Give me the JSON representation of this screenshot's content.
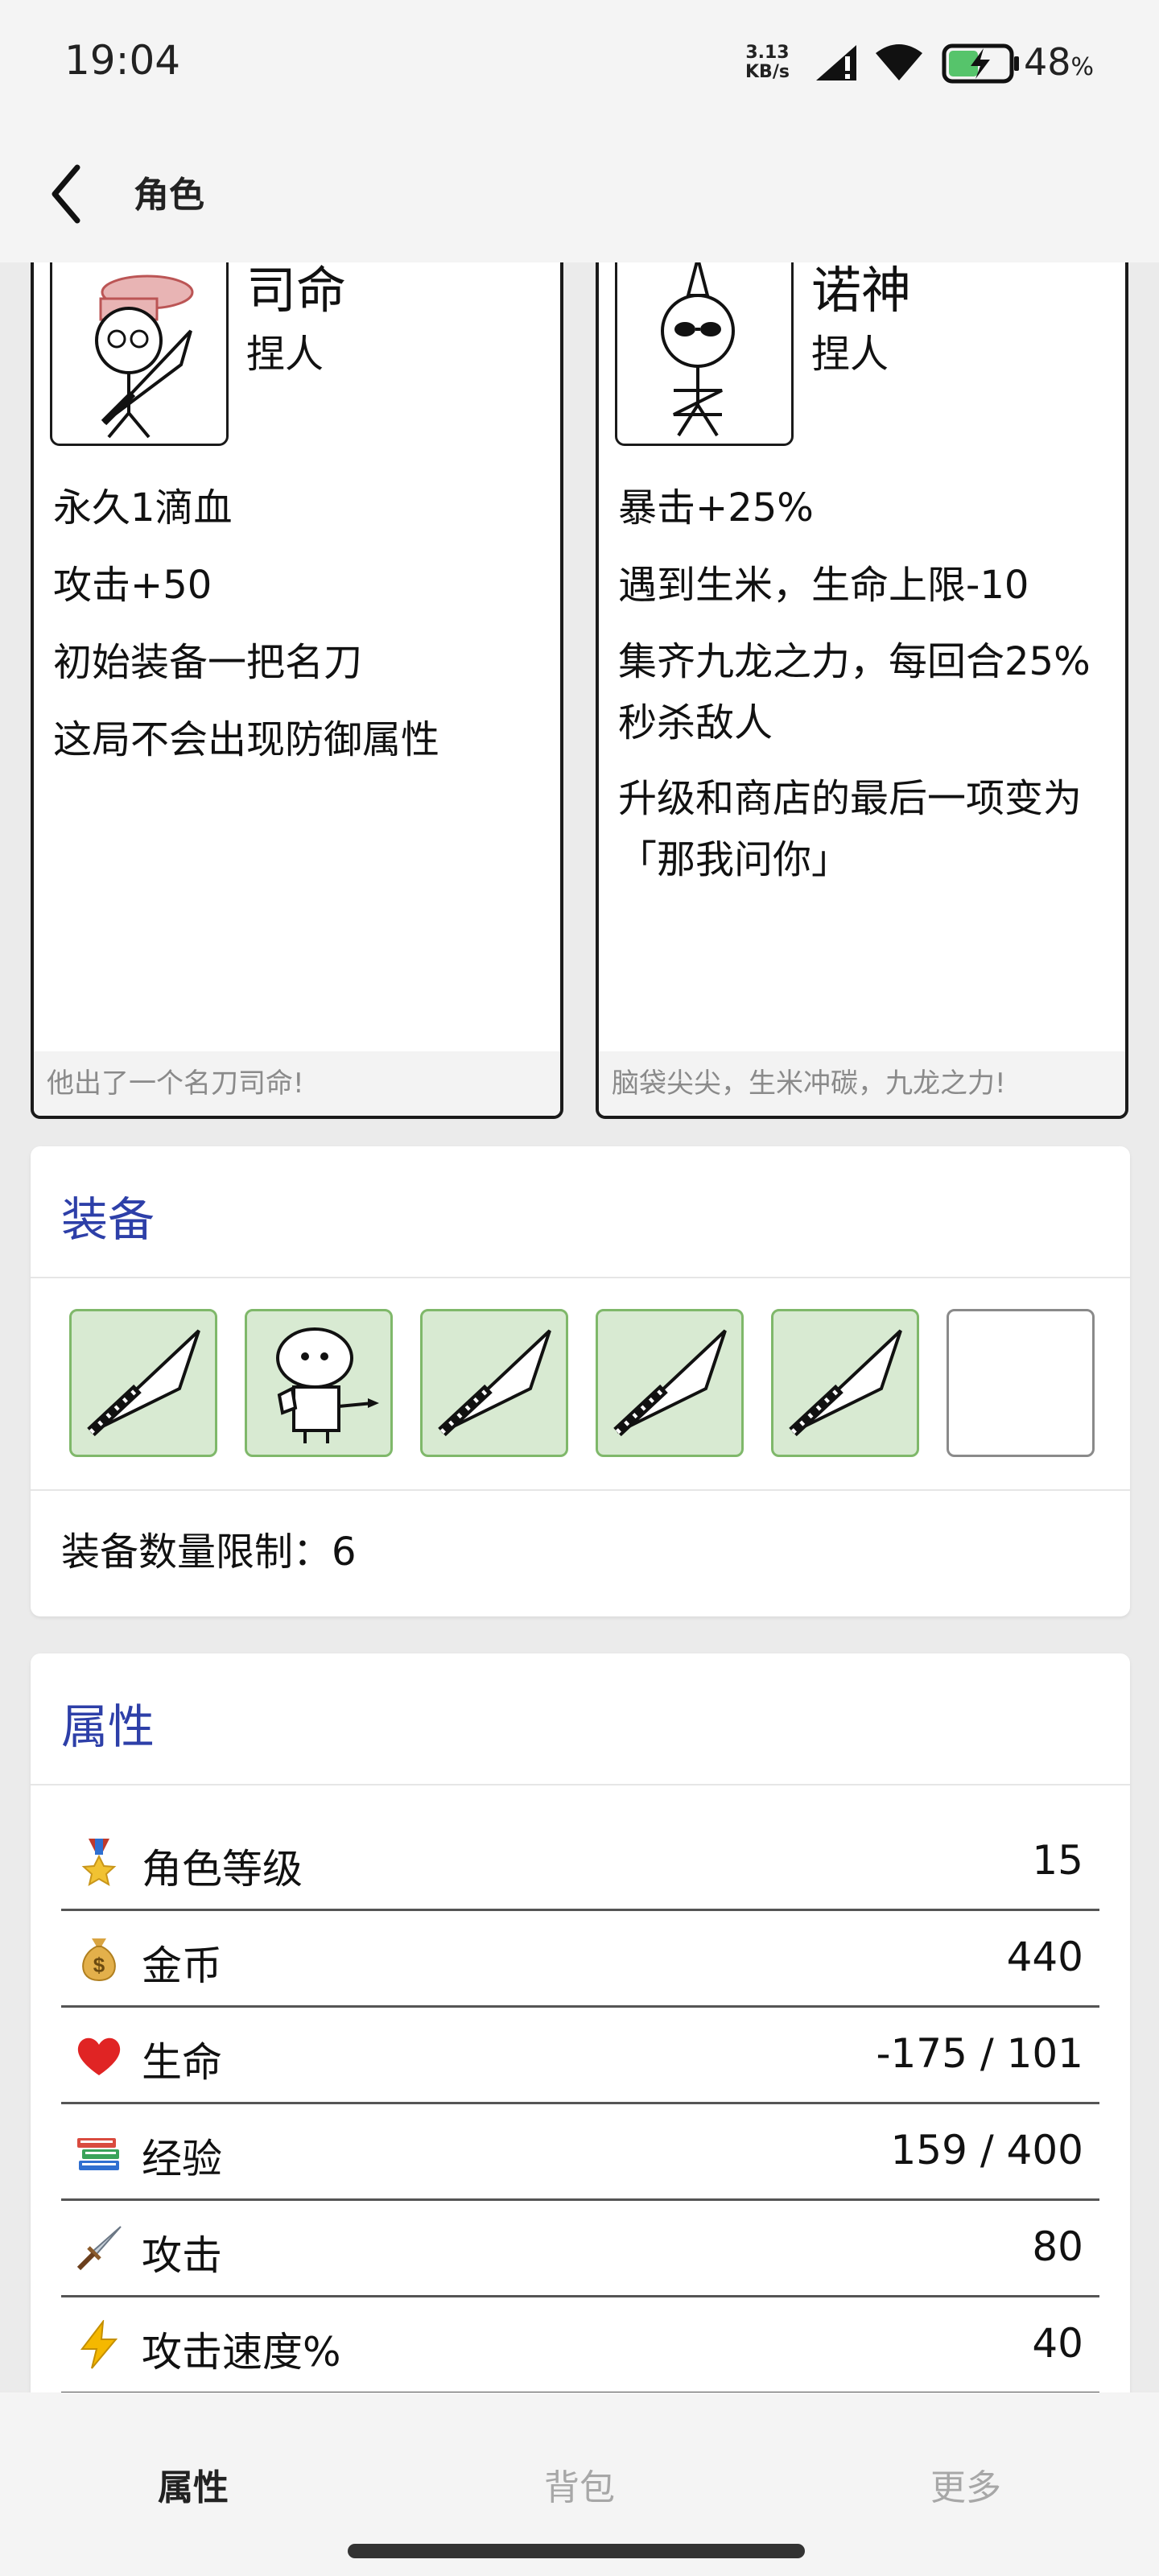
{
  "status_bar": {
    "time": "19:04",
    "net_speed_value": "3.13",
    "net_speed_unit": "KB/s",
    "battery_level": "48",
    "battery_unit": "%"
  },
  "app_bar": {
    "title": "角色"
  },
  "characters": [
    {
      "name": "司命",
      "role": "捏人",
      "traits": [
        "永久1滴血",
        "攻击+50",
        "初始装备一把名刀",
        "这局不会出现防御属性"
      ],
      "footer": "他出了一个名刀司命!"
    },
    {
      "name": "诺神",
      "role": "捏人",
      "traits": [
        "暴击+25%",
        "遇到生米，生命上限-10",
        "集齐九龙之力，每回合25%秒杀敌人",
        "升级和商店的最后一项变为「那我问你」"
      ],
      "footer": "脑袋尖尖，生米冲碳，九龙之力!"
    }
  ],
  "equipment": {
    "title": "装备",
    "slots": [
      {
        "icon": "dagger-icon"
      },
      {
        "icon": "stickman-figure-icon"
      },
      {
        "icon": "dagger-icon"
      },
      {
        "icon": "dagger-icon"
      },
      {
        "icon": "dagger-icon"
      },
      {
        "icon": "empty-slot"
      }
    ],
    "limit_label": "装备数量限制：6"
  },
  "attributes": {
    "title": "属性",
    "rows": [
      {
        "icon": "medal-icon",
        "label": "角色等级",
        "value": "15"
      },
      {
        "icon": "money-bag-icon",
        "label": "金币",
        "value": "440"
      },
      {
        "icon": "heart-icon",
        "label": "生命",
        "value": "-175 / 101"
      },
      {
        "icon": "books-icon",
        "label": "经验",
        "value": "159 / 400"
      },
      {
        "icon": "dagger-icon",
        "label": "攻击",
        "value": "80"
      },
      {
        "icon": "lightning-icon",
        "label": "攻击速度%",
        "value": "40"
      }
    ]
  },
  "bottom_nav": {
    "items": [
      "属性",
      "背包",
      "更多"
    ],
    "active_color": "#222222",
    "inactive_color": "#a7a7a7"
  },
  "colors": {
    "accent": "#2d3fa8",
    "equip_slot_fill": "#d8ead2",
    "equip_slot_border": "#7fb86a"
  }
}
